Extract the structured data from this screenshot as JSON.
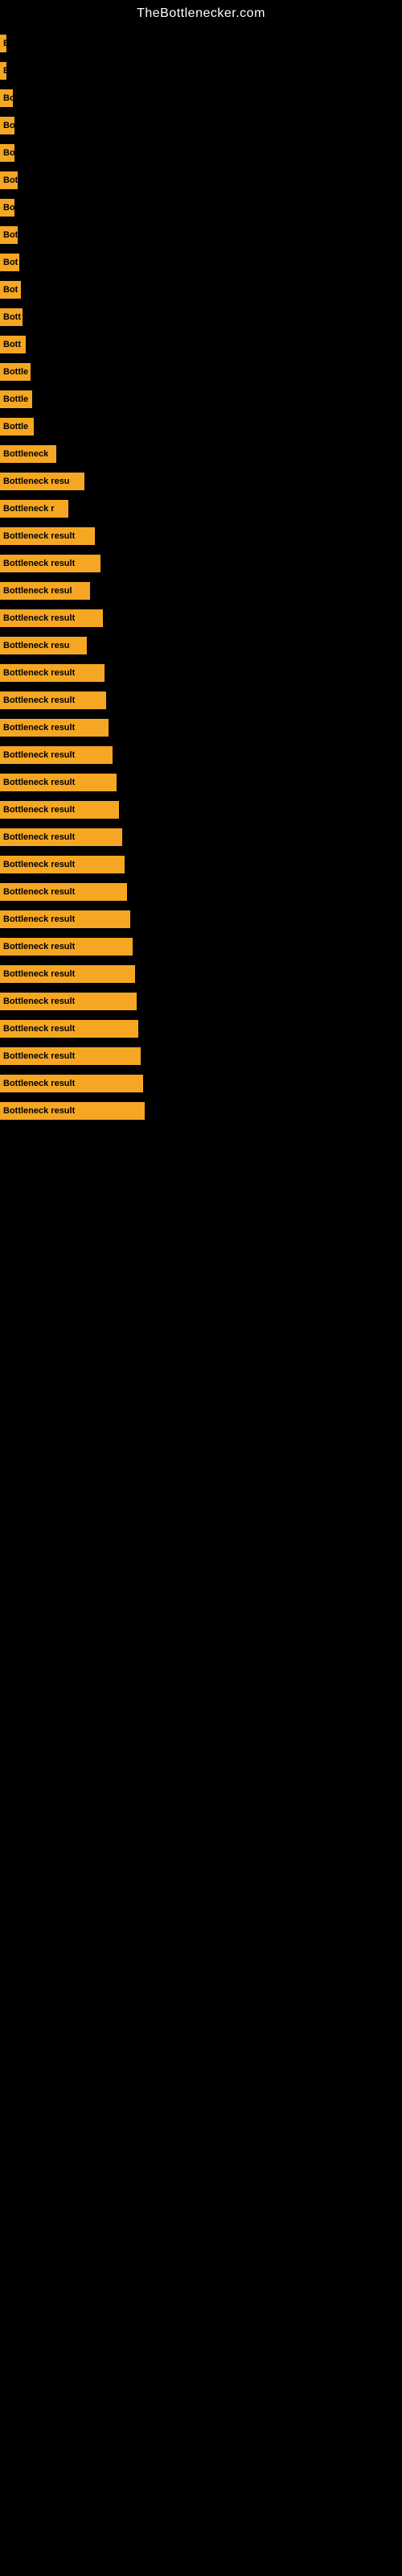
{
  "header": {
    "title": "TheBottlenecker.com"
  },
  "bars": [
    {
      "label": "B",
      "width": 8
    },
    {
      "label": "B",
      "width": 8
    },
    {
      "label": "Bo",
      "width": 16
    },
    {
      "label": "Bo",
      "width": 18
    },
    {
      "label": "Bo",
      "width": 18
    },
    {
      "label": "Bot",
      "width": 22
    },
    {
      "label": "Bo",
      "width": 18
    },
    {
      "label": "Bot",
      "width": 22
    },
    {
      "label": "Bot",
      "width": 24
    },
    {
      "label": "Bot",
      "width": 26
    },
    {
      "label": "Bott",
      "width": 28
    },
    {
      "label": "Bott",
      "width": 32
    },
    {
      "label": "Bottle",
      "width": 38
    },
    {
      "label": "Bottle",
      "width": 40
    },
    {
      "label": "Bottle",
      "width": 42
    },
    {
      "label": "Bottleneck",
      "width": 70
    },
    {
      "label": "Bottleneck resu",
      "width": 105
    },
    {
      "label": "Bottleneck r",
      "width": 85
    },
    {
      "label": "Bottleneck result",
      "width": 118
    },
    {
      "label": "Bottleneck result",
      "width": 125
    },
    {
      "label": "Bottleneck resul",
      "width": 112
    },
    {
      "label": "Bottleneck result",
      "width": 128
    },
    {
      "label": "Bottleneck resu",
      "width": 108
    },
    {
      "label": "Bottleneck result",
      "width": 130
    },
    {
      "label": "Bottleneck result",
      "width": 132
    },
    {
      "label": "Bottleneck result",
      "width": 135
    },
    {
      "label": "Bottleneck result",
      "width": 140
    },
    {
      "label": "Bottleneck result",
      "width": 145
    },
    {
      "label": "Bottleneck result",
      "width": 148
    },
    {
      "label": "Bottleneck result",
      "width": 152
    },
    {
      "label": "Bottleneck result",
      "width": 155
    },
    {
      "label": "Bottleneck result",
      "width": 158
    },
    {
      "label": "Bottleneck result",
      "width": 162
    },
    {
      "label": "Bottleneck result",
      "width": 165
    },
    {
      "label": "Bottleneck result",
      "width": 168
    },
    {
      "label": "Bottleneck result",
      "width": 170
    },
    {
      "label": "Bottleneck result",
      "width": 172
    },
    {
      "label": "Bottleneck result",
      "width": 175
    },
    {
      "label": "Bottleneck result",
      "width": 178
    },
    {
      "label": "Bottleneck result",
      "width": 180
    }
  ]
}
